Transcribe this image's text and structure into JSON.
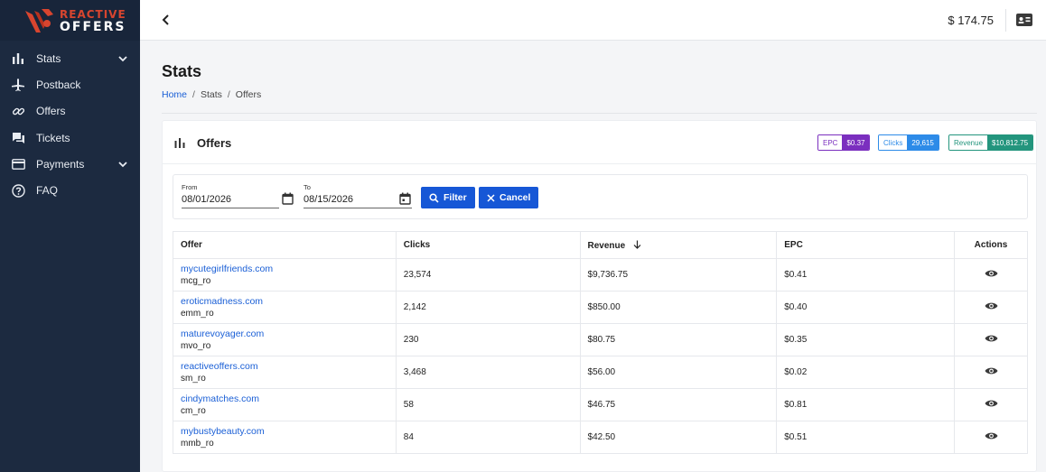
{
  "brand": {
    "line1": "REACTIVE",
    "line2": "OFFERS"
  },
  "sidebar": {
    "items": [
      {
        "label": "Stats",
        "icon": "bar-chart-icon",
        "expandable": true
      },
      {
        "label": "Postback",
        "icon": "airplane-icon",
        "expandable": false
      },
      {
        "label": "Offers",
        "icon": "link-icon",
        "expandable": false
      },
      {
        "label": "Tickets",
        "icon": "chat-icon",
        "expandable": false
      },
      {
        "label": "Payments",
        "icon": "credit-card-icon",
        "expandable": true
      },
      {
        "label": "FAQ",
        "icon": "help-circle-icon",
        "expandable": false
      }
    ]
  },
  "topbar": {
    "balance": "$ 174.75"
  },
  "page": {
    "title": "Stats",
    "breadcrumb": [
      "Home",
      "Stats",
      "Offers"
    ]
  },
  "card": {
    "title": "Offers",
    "stats": {
      "epc": {
        "label": "EPC",
        "value": "$0.37",
        "color": "#7b2fbf"
      },
      "clicks": {
        "label": "Clicks",
        "value": "29,615",
        "color": "#2d8be8"
      },
      "revenue": {
        "label": "Revenue",
        "value": "$10,812.75",
        "color": "#23957d"
      }
    }
  },
  "filter": {
    "from_label": "From",
    "from_value": "08/01/2026",
    "to_label": "To",
    "to_value": "08/15/2026",
    "filter_button": "Filter",
    "cancel_button": "Cancel"
  },
  "table": {
    "headers": {
      "offer": "Offer",
      "clicks": "Clicks",
      "revenue": "Revenue",
      "epc": "EPC",
      "actions": "Actions"
    },
    "rows": [
      {
        "offer": "mycutegirlfriends.com",
        "code": "mcg_ro",
        "clicks": "23,574",
        "revenue": "$9,736.75",
        "epc": "$0.41"
      },
      {
        "offer": "eroticmadness.com",
        "code": "emm_ro",
        "clicks": "2,142",
        "revenue": "$850.00",
        "epc": "$0.40"
      },
      {
        "offer": "maturevoyager.com",
        "code": "mvo_ro",
        "clicks": "230",
        "revenue": "$80.75",
        "epc": "$0.35"
      },
      {
        "offer": "reactiveoffers.com",
        "code": "sm_ro",
        "clicks": "3,468",
        "revenue": "$56.00",
        "epc": "$0.02"
      },
      {
        "offer": "cindymatches.com",
        "code": "cm_ro",
        "clicks": "58",
        "revenue": "$46.75",
        "epc": "$0.81"
      },
      {
        "offer": "mybustybeauty.com",
        "code": "mmb_ro",
        "clicks": "84",
        "revenue": "$42.50",
        "epc": "$0.51"
      }
    ]
  }
}
